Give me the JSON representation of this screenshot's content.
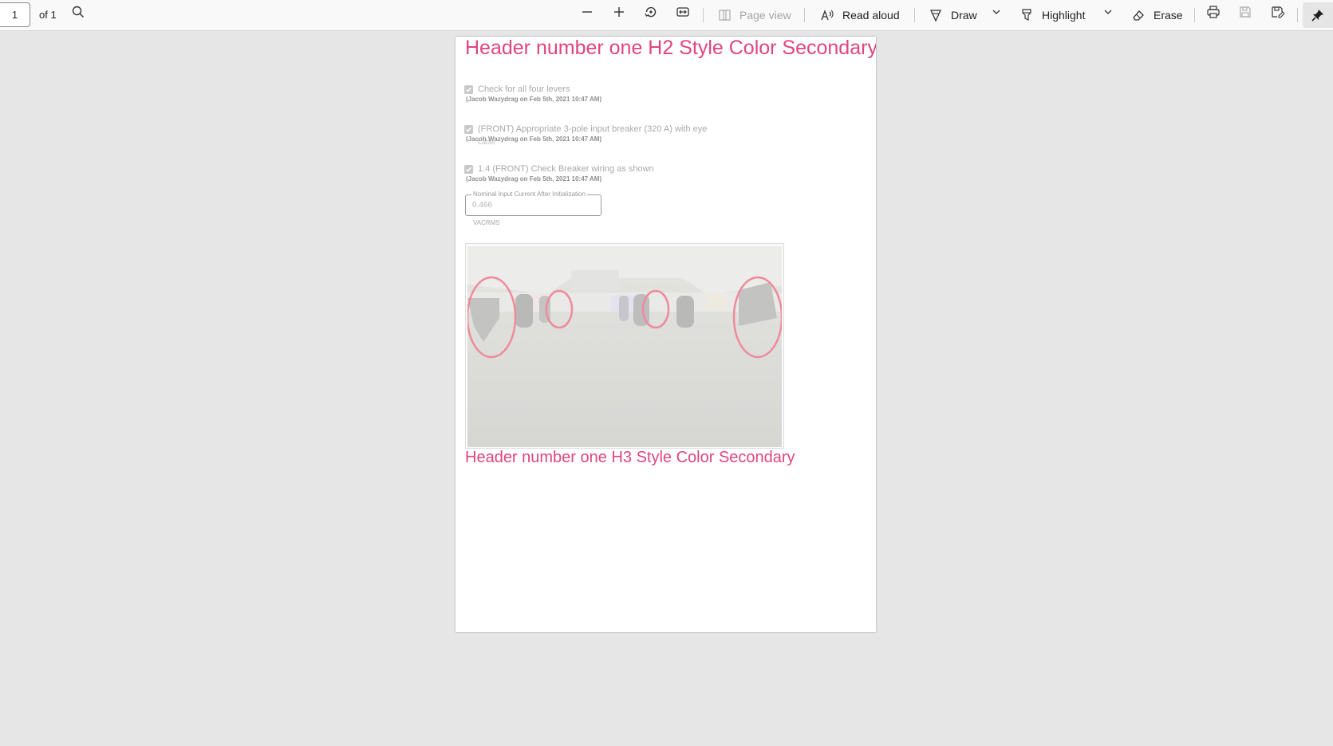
{
  "toolbar": {
    "page_number": "1",
    "page_total": "of 1",
    "page_view_label": "Page view",
    "read_aloud_label": "Read aloud",
    "draw_label": "Draw",
    "highlight_label": "Highlight",
    "erase_label": "Erase"
  },
  "document": {
    "h2": "Header number one H2 Style Color Secondary",
    "checks": [
      {
        "label": "Check for all four levers",
        "meta": "(Jacob Wazydrag on Feb 5th, 2021 10:47 AM)"
      },
      {
        "label": "(FRONT) Appropriate 3-pole input breaker (320 A) with eye",
        "meta": "(Jacob Wazydrag on Feb 5th, 2021 10:47 AM)"
      },
      {
        "label": "1.4 (FRONT) Check Breaker wiring as shown",
        "meta": "(Jacob Wazydrag on Feb 5th, 2021 10:47 AM)"
      }
    ],
    "overlap_label": "Label",
    "field": {
      "legend": "Nominal Input Current After Initialization",
      "value": "0.466",
      "unit": "VACRMS"
    },
    "h3": "Header number one H3 Style Color Secondary"
  },
  "colors": {
    "secondary": "#e0457d",
    "annotation_circle": "#f08a9a"
  }
}
